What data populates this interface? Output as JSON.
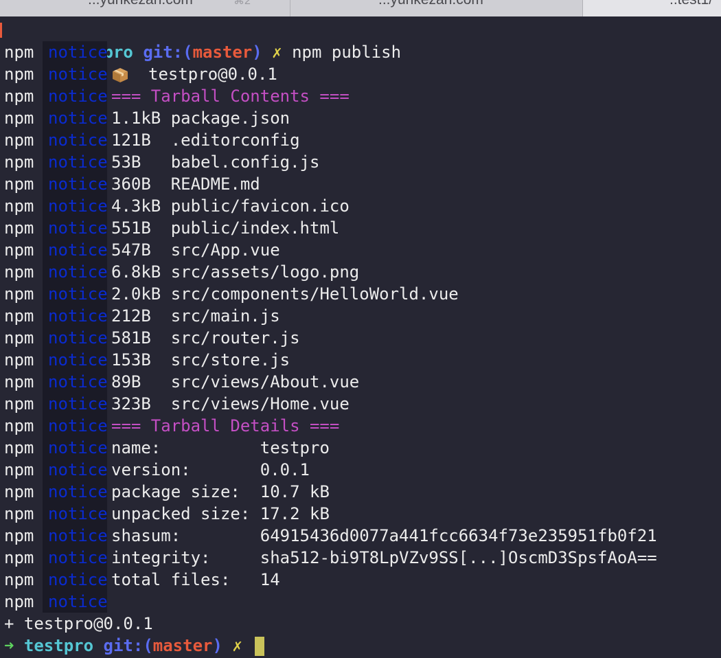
{
  "tabs": [
    {
      "title": "...yunkezan.com",
      "shortcut": "⌘2",
      "has_menu": true
    },
    {
      "title": "...yunkezan.com",
      "shortcut": "",
      "has_menu": false
    },
    {
      "title": "..test1/",
      "shortcut": "",
      "has_menu": false
    }
  ],
  "prompt1": {
    "arrow": "➜",
    "dir": "testpro",
    "git_prefix": "git:(",
    "branch": "master",
    "git_suffix": ")",
    "dirty": "✗",
    "command": "npm publish"
  },
  "npm_label": "npm",
  "notice_label": "notice",
  "package_line": "testpro@0.0.1",
  "contents_header": "=== Tarball Contents ===",
  "files": [
    {
      "size": "1.1kB",
      "path": "package.json"
    },
    {
      "size": "121B ",
      "path": ".editorconfig"
    },
    {
      "size": "53B  ",
      "path": "babel.config.js"
    },
    {
      "size": "360B ",
      "path": "README.md"
    },
    {
      "size": "4.3kB",
      "path": "public/favicon.ico"
    },
    {
      "size": "551B ",
      "path": "public/index.html"
    },
    {
      "size": "547B ",
      "path": "src/App.vue"
    },
    {
      "size": "6.8kB",
      "path": "src/assets/logo.png"
    },
    {
      "size": "2.0kB",
      "path": "src/components/HelloWorld.vue"
    },
    {
      "size": "212B ",
      "path": "src/main.js"
    },
    {
      "size": "581B ",
      "path": "src/router.js"
    },
    {
      "size": "153B ",
      "path": "src/store.js"
    },
    {
      "size": "89B  ",
      "path": "src/views/About.vue"
    },
    {
      "size": "323B ",
      "path": "src/views/Home.vue"
    }
  ],
  "details_header": "=== Tarball Details ===",
  "details": [
    {
      "key": "name:          ",
      "value": "testpro"
    },
    {
      "key": "version:       ",
      "value": "0.0.1"
    },
    {
      "key": "package size:  ",
      "value": "10.7 kB"
    },
    {
      "key": "unpacked size: ",
      "value": "17.2 kB"
    },
    {
      "key": "shasum:        ",
      "value": "64915436d0077a441fcc6634f73e235951fb0f21"
    },
    {
      "key": "integrity:     ",
      "value": "sha512-bi9T8LpVZv9SS[...]OscmD3SpsfAoA=="
    },
    {
      "key": "total files:   ",
      "value": "14"
    }
  ],
  "published_line": "+ testpro@0.0.1",
  "prompt2": {
    "arrow": "➜",
    "dir": "testpro",
    "git_prefix": "git:(",
    "branch": "master",
    "git_suffix": ")",
    "dirty": "✗"
  },
  "colors": {
    "background": "#262633",
    "notice": "#0a2bd0",
    "header_magenta": "#c44fc4",
    "prompt_dir": "#55c7d4",
    "git": "#5a6cf0",
    "branch": "#e85a3c",
    "cursor": "#c9c25a"
  },
  "icons": [
    "package-icon",
    "prompt-arrow-icon",
    "dirty-mark-icon",
    "tab-menu-icon"
  ]
}
